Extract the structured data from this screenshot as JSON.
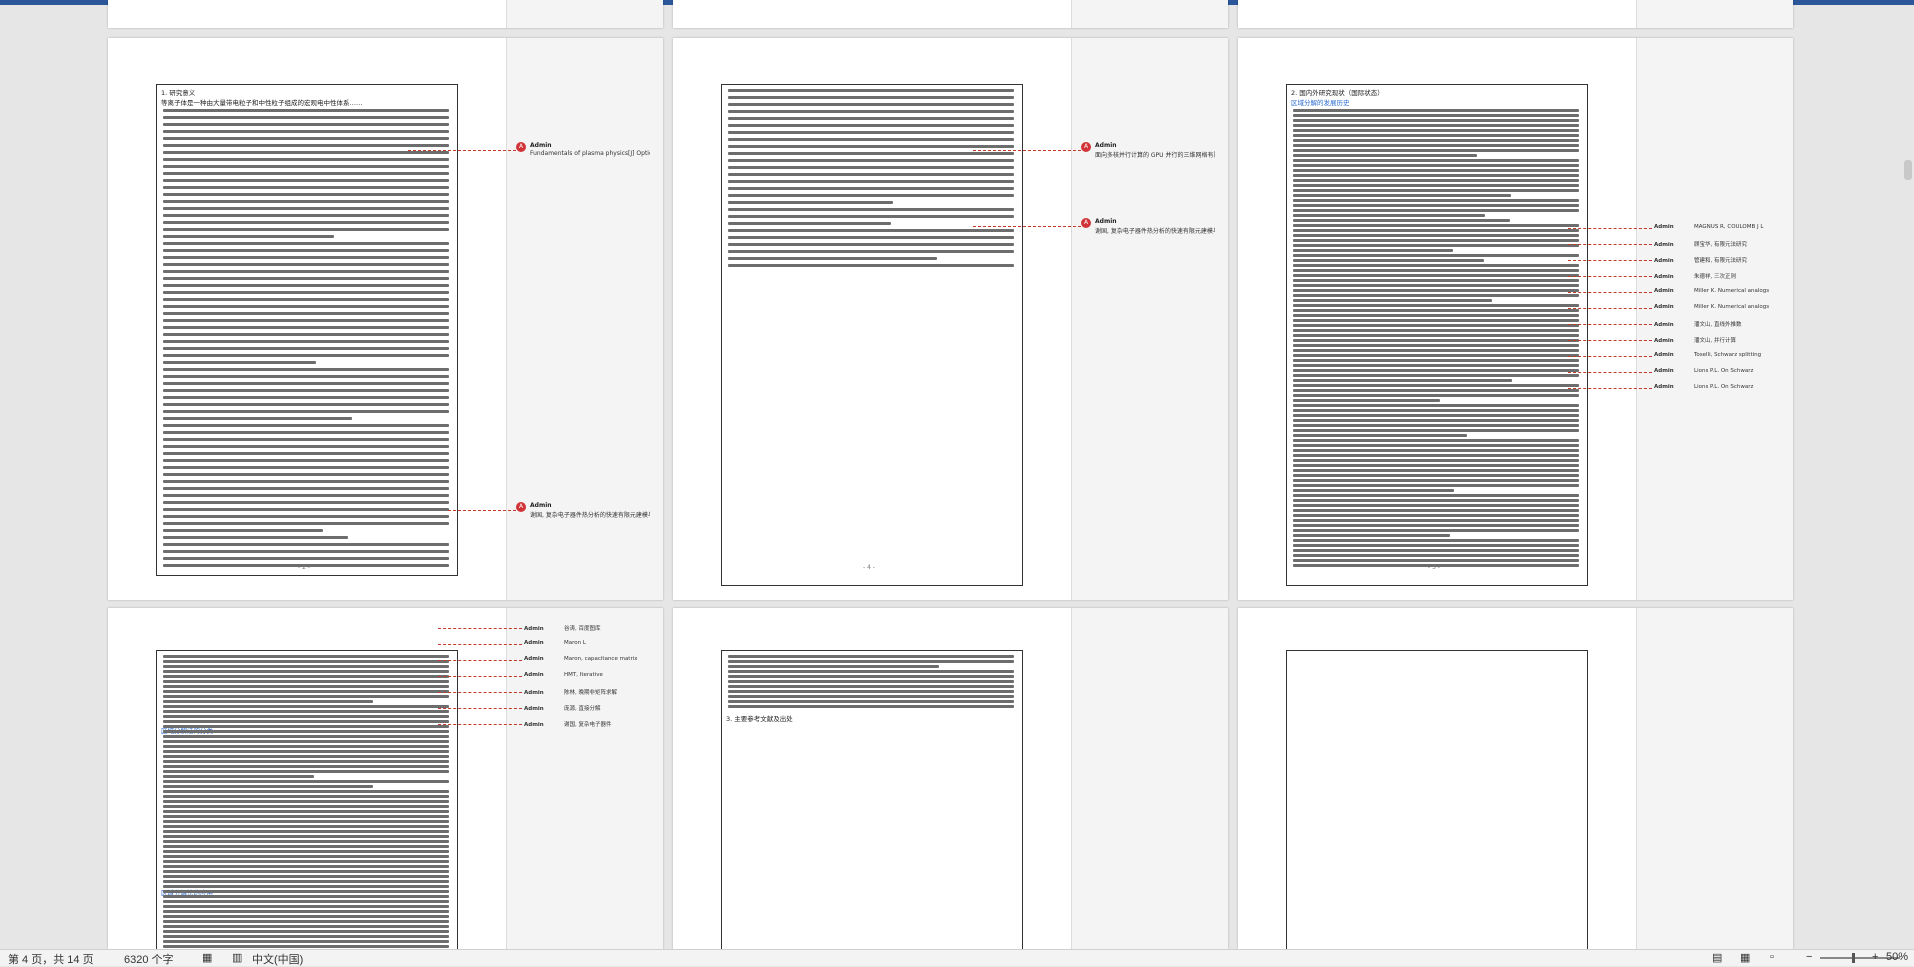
{
  "pages": [
    {
      "label": "- 2 -",
      "comments": [
        {
          "author": "Admin",
          "text": "Fundamentals of plasma physics[J] Optics Acta International Journal of Optics, 2006, 20(7):883-883."
        },
        {
          "author": "Admin",
          "text": "谢国, 复杂电子器件热分析的快速有限元建模与 CAD 技术研究"
        }
      ],
      "lines": [
        "1. 研究意义",
        "    等离子体是一种由大量带电粒子和中性粒子组成的宏观电中性体系……"
      ]
    },
    {
      "label": "- 4 -",
      "comments": [
        {
          "author": "Admin",
          "text": "面向多核并行计算的 GPU 并行的三维网格有限元建模方法研究"
        },
        {
          "author": "Admin",
          "text": "谢国, 复杂电子器件热分析的快速有限元建模与 CAD 技术研究"
        }
      ]
    },
    {
      "label": "- 5 -",
      "minis": [
        "MAGNUS R, COULOMB J L",
        "顾宝华, 有限元法研究",
        "管建和, 有限元法研究",
        "朱德祥, 三次正则",
        "Miller K. Numerical analogs",
        "Miller K. Numerical analogs",
        "潘文山, 直线外推数",
        "潘文山, 并行计算",
        "Toselli, Schwarz splitting",
        "Lions P.L. On Schwarz",
        "Lions P.L. On Schwarz"
      ],
      "lines": [
        "2. 国内外研究现状（国际状态）",
        "区域分解的发展历史"
      ]
    },
    {
      "label": "",
      "minis": [
        "谷涛, 百度图库",
        "Maron L",
        "Maron, capacitance matrix",
        "HMT, Iterative",
        "陈林, 晚期非矩阵求解",
        "庞源, 直接分解",
        "谢国, 复杂电子器件"
      ],
      "lines": [
        "区域分解法的分类",
        "区域分解法的应用"
      ]
    },
    {
      "label": "",
      "lines": [
        "3. 主要参考文献及出处"
      ]
    },
    {
      "label": ""
    }
  ],
  "status": {
    "page": "第 4 页，共 14 页",
    "words": "6320 个字",
    "lang": "中文(中国)",
    "zoom": "50%"
  }
}
